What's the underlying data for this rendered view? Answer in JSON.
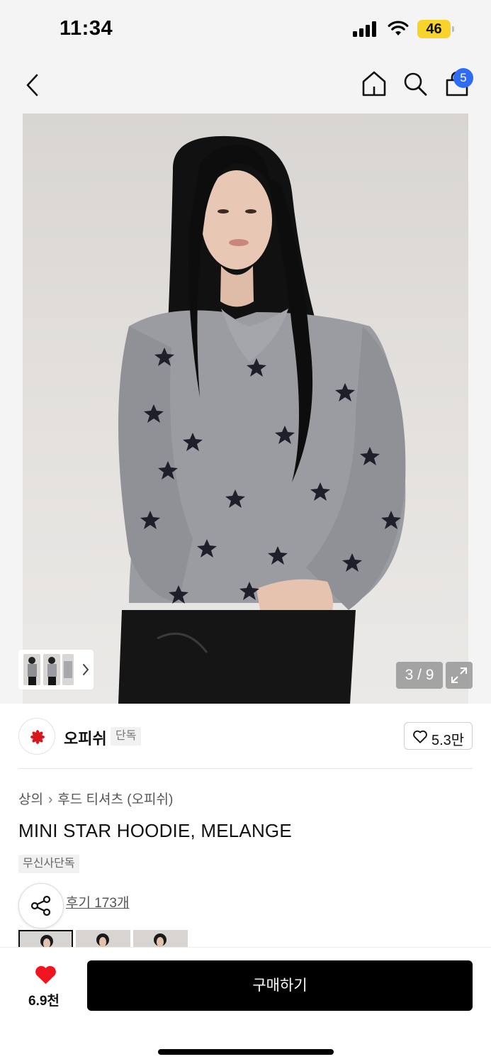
{
  "status_bar": {
    "time": "11:34",
    "battery_level": "46",
    "icons": [
      "signal-icon",
      "wifi-icon",
      "battery-icon"
    ]
  },
  "nav": {
    "icons": [
      "back-icon",
      "home-icon",
      "search-icon",
      "bag-icon"
    ],
    "cart_badge": "5"
  },
  "gallery": {
    "counter": "3 / 9",
    "icons": [
      "chevron-right-icon",
      "expand-icon"
    ]
  },
  "brand": {
    "name": "오피쉬",
    "tag": "단독",
    "likes": "5.3만"
  },
  "product": {
    "breadcrumb": [
      "상의",
      "후드 티셔츠 (오피쉬)"
    ],
    "title": "MINI STAR HOODIE, MELANGE",
    "tag": "무신사단독",
    "review_link": "후기 173개"
  },
  "bottom_bar": {
    "wish_count": "6.9천",
    "buy_label": "구매하기"
  },
  "colors": {
    "accent_blue": "#2f6cf6",
    "heart_red": "#f0141e",
    "battery_yellow": "#f8d32a",
    "buy_button": "#000000"
  }
}
